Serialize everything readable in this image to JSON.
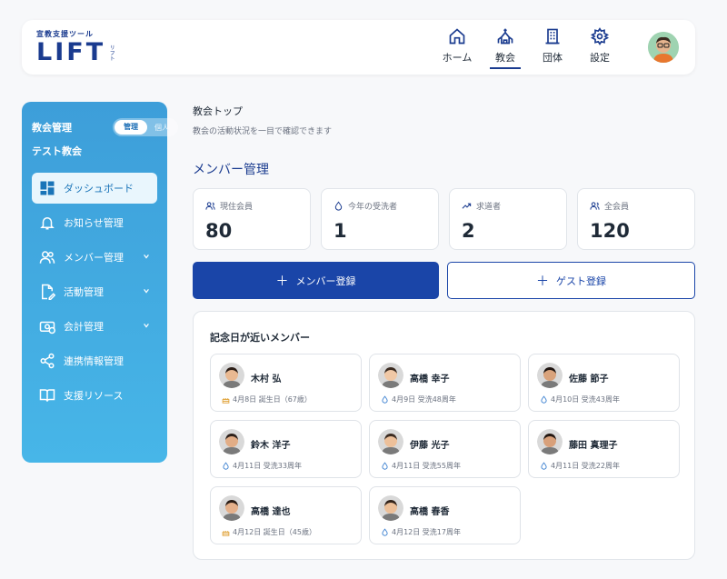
{
  "header": {
    "logo_sub": "宣教支援ツール",
    "logo_main": "LIFT",
    "logo_kana": "リフト",
    "nav": [
      {
        "label": "ホーム",
        "icon": "home-icon"
      },
      {
        "label": "教会",
        "icon": "church-icon",
        "active": true
      },
      {
        "label": "団体",
        "icon": "building-icon"
      },
      {
        "label": "設定",
        "icon": "gear-icon"
      }
    ]
  },
  "sidebar": {
    "title": "教会管理",
    "toggle_on": "管理",
    "toggle_off": "個人",
    "church_name": "テスト教会",
    "items": [
      {
        "label": "ダッシュボード",
        "icon": "dashboard-icon",
        "active": true
      },
      {
        "label": "お知らせ管理",
        "icon": "bell-icon"
      },
      {
        "label": "メンバー管理",
        "icon": "users-icon",
        "expandable": true
      },
      {
        "label": "活動管理",
        "icon": "document-edit-icon",
        "expandable": true
      },
      {
        "label": "会計管理",
        "icon": "money-icon",
        "expandable": true
      },
      {
        "label": "連携情報管理",
        "icon": "share-icon"
      },
      {
        "label": "支援リソース",
        "icon": "book-icon"
      }
    ]
  },
  "main": {
    "title": "教会トップ",
    "subtitle": "教会の活動状況を一目で確認できます",
    "section_title": "メンバー管理",
    "stats": [
      {
        "label": "現住会員",
        "value": "80",
        "icon": "users-icon"
      },
      {
        "label": "今年の受洗者",
        "value": "1",
        "icon": "water-drop-icon"
      },
      {
        "label": "求道者",
        "value": "2",
        "icon": "trend-up-icon"
      },
      {
        "label": "全会員",
        "value": "120",
        "icon": "users-icon"
      }
    ],
    "buttons": {
      "member_register": "メンバー登録",
      "guest_register": "ゲスト登録"
    },
    "anniversary": {
      "title": "記念日が近いメンバー",
      "members": [
        {
          "name": "木村 弘",
          "detail": "4月8日 誕生日（67歳）",
          "type": "birthday"
        },
        {
          "name": "高橋 幸子",
          "detail": "4月9日 受洗48周年",
          "type": "baptism"
        },
        {
          "name": "佐藤 節子",
          "detail": "4月10日 受洗43周年",
          "type": "baptism"
        },
        {
          "name": "鈴木 洋子",
          "detail": "4月11日 受洗33周年",
          "type": "baptism"
        },
        {
          "name": "伊藤 光子",
          "detail": "4月11日 受洗55周年",
          "type": "baptism"
        },
        {
          "name": "藤田 真理子",
          "detail": "4月11日 受洗22周年",
          "type": "baptism"
        },
        {
          "name": "高橋 達也",
          "detail": "4月12日 誕生日（45歳）",
          "type": "birthday"
        },
        {
          "name": "高橋 春香",
          "detail": "4月12日 受洗17周年",
          "type": "baptism"
        }
      ]
    }
  },
  "colors": {
    "brand": "#1a3b8f",
    "primary_button": "#1a45a8",
    "sidebar_top": "#3d9ed9",
    "sidebar_bottom": "#47b6e8",
    "birthday_icon": "#e0a33a",
    "baptism_icon": "#3a7fd0"
  }
}
